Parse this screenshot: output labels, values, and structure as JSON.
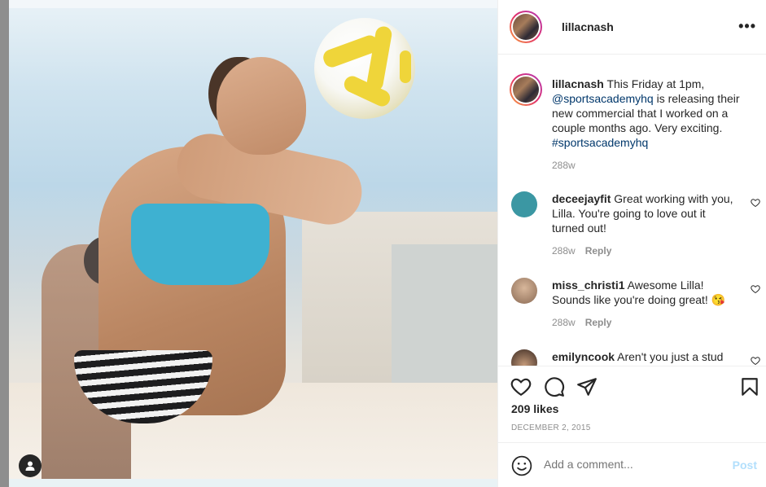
{
  "post": {
    "username": "lillacnash",
    "more_label": "•••"
  },
  "caption": {
    "username": "lillacnash",
    "text_before": " This Friday at 1pm, ",
    "mention": "@sportsacademyhq",
    "text_after": " is releasing their new commercial that I worked on a couple months ago. Very exciting. ",
    "hashtag": "#sportsacademyhq",
    "time": "288w"
  },
  "comments": [
    {
      "username": "deceejayfit",
      "text": " Great working with you, Lilla. You're going to love out it turned out!",
      "time": "288w",
      "reply": "Reply",
      "avatar_color": "#3b97a3"
    },
    {
      "username": "miss_christi1",
      "text": " Awesome Lilla! Sounds like you're doing great! 😘",
      "time": "288w",
      "reply": "Reply",
      "avatar_color": "#a07a5e"
    },
    {
      "username": "emilyncook",
      "text": " Aren't you just a stud",
      "avatar_color": "#5a3b2e"
    }
  ],
  "actions": {
    "likes": "209 likes",
    "date": "DECEMBER 2, 2015"
  },
  "add_comment": {
    "placeholder": "Add a comment...",
    "post_label": "Post"
  },
  "colors": {
    "link": "#00376b",
    "muted": "#8e8e8e",
    "post_disabled": "#b2dffc"
  }
}
